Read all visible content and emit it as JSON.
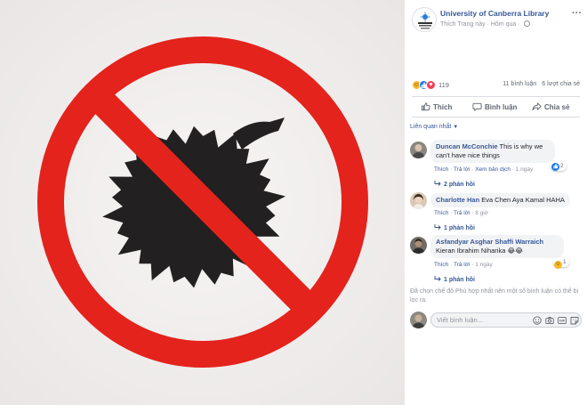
{
  "colors": {
    "brand_blue": "#365899",
    "sign_red": "#e3231c",
    "meta_gray": "#90949c",
    "comment_bg": "#f2f3f5"
  },
  "post": {
    "page_name": "University of Canberra Library",
    "liked_label": "Thích Trang này",
    "separator": "·",
    "time": "Hôm qua",
    "more_label": "···",
    "reaction_icons": [
      "haha-icon",
      "like-icon",
      "love-icon"
    ],
    "reaction_count": "119",
    "comment_count": "11 bình luận",
    "share_count": "6 lượt chia sẻ"
  },
  "actions": {
    "like": "Thích",
    "comment": "Bình luận",
    "share": "Chia sẻ"
  },
  "comments_header": {
    "sort_label": "Liên quan nhất"
  },
  "comments": [
    {
      "author": "Duncan McConchie",
      "text": "This is why we can't have nice things",
      "like": "Thích",
      "reply": "Trả lời",
      "translate": "Xem bản dịch",
      "time": "1 ngày",
      "reaction_count": "2",
      "reaction_icon": "like-icon",
      "replies": "2 phản hồi"
    },
    {
      "author": "Charlotte Han",
      "text": "Eva Chen Aya Kamal HAHA",
      "like": "Thích",
      "reply": "Trả lời",
      "time": "8 giờ",
      "replies": "1 phản hồi"
    },
    {
      "author": "Asfandyar Asghar Shaffi Warraich",
      "text": "Kieran Ibrahim Niharika 😂😂",
      "like": "Thích",
      "reply": "Trả lời",
      "time": "1 ngày",
      "reaction_count": "1",
      "reaction_icon": "haha-icon",
      "replies": "1 phản hồi"
    }
  ],
  "filter_note": "Đã chọn chế độ Phù hợp nhất nên một số bình luận có thể bị lọc ra.",
  "composer": {
    "placeholder": "Viết bình luận...",
    "icons": [
      "emoji-icon",
      "camera-icon",
      "gif-icon",
      "sticker-icon"
    ]
  }
}
